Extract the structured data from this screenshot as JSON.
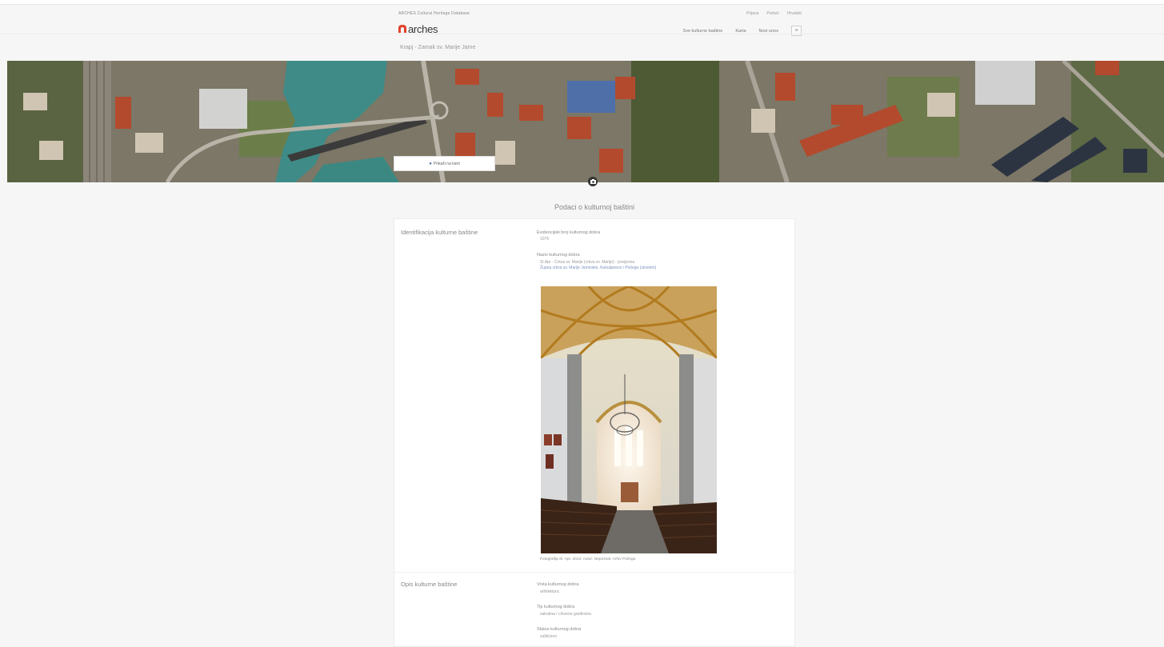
{
  "header": {
    "tagline": "ARCHES Cultural Heritage Database",
    "utility_links": [
      "Prijava",
      "Pomoć",
      "Hrvatski"
    ],
    "logo_text": "arches",
    "nav": [
      "Sve kulturne baštine",
      "Karta",
      "Novi unos"
    ],
    "menu_icon": "hamburger-menu-icon"
  },
  "breadcrumb": "Krapj - Zamak sv. Marije Jame",
  "map": {
    "button_label": "Prikaži na karti",
    "button_icon": "map-marker-icon",
    "gallery_icon": "camera-icon"
  },
  "report": {
    "title": "Podaci o kulturnoj baštini",
    "sections": [
      {
        "label": "Identifikacija kulturne baštine",
        "fields": [
          {
            "label": "Evidencijski broj kulturnog dobra",
            "value": "1076"
          },
          {
            "label": "Naziv kulturnog dobra",
            "value_lines": [
              "Sl.Apr - Crkva sv. Marije (crkva sv. Marije) - povijesna",
              "Župna crkva sv. Marije Jaminske, Kukuljanovo i Požega (sinonim)"
            ]
          }
        ],
        "photo_caption": "Fotografija Sl. Apr, 2013. Autor: Nepoznat, Arhiv Požega"
      },
      {
        "label": "Opis kulturne baštine",
        "fields": [
          {
            "label": "Vrsta kulturnog dobra",
            "value": "arhitektura"
          },
          {
            "label": "Tip kulturnog dobra",
            "value": "sakralna / crkvena građevina"
          },
          {
            "label": "Status kulturnog dobra",
            "value": "zaštićeno"
          }
        ]
      }
    ]
  }
}
